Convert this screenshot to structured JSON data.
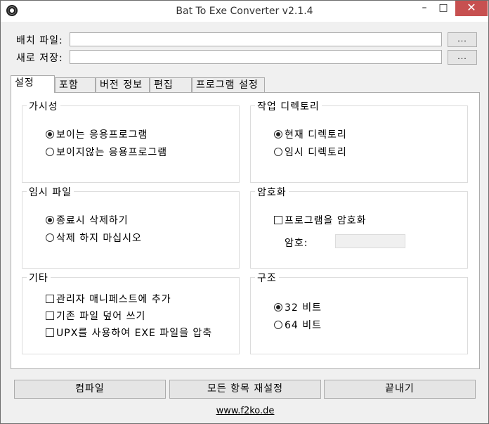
{
  "window": {
    "title": "Bat To Exe Converter v2.1.4",
    "minimize": "–",
    "maximize": "□",
    "close": "✕"
  },
  "fields": {
    "batch_file_label": "배치 파일:",
    "batch_file_value": "",
    "save_as_label": "새로 저장:",
    "save_as_value": "",
    "browse_label": "..."
  },
  "tabs": [
    {
      "label": "설정"
    },
    {
      "label": "포함"
    },
    {
      "label": "버전 정보"
    },
    {
      "label": "편집"
    },
    {
      "label": "프로그램 설정"
    }
  ],
  "settings": {
    "visibility": {
      "title": "가시성",
      "options": [
        "보이는 응용프로그램",
        "보이지않는 응용프로그램"
      ],
      "selected": 0
    },
    "working_dir": {
      "title": "작업 디렉토리",
      "options": [
        "현재 디렉토리",
        "임시 디렉토리"
      ],
      "selected": 0
    },
    "temp_file": {
      "title": "임시 파일",
      "options": [
        "종료시 삭제하기",
        "삭제 하지 마십시오"
      ],
      "selected": 0
    },
    "encryption": {
      "title": "암호화",
      "encrypt_label": "프로그램을 암호화",
      "encrypt_checked": false,
      "password_label": "암호:",
      "password_value": ""
    },
    "other": {
      "title": "기타",
      "options": [
        {
          "label": "관리자 매니페스트에 추가",
          "checked": false
        },
        {
          "label": "기존 파일 덮어 쓰기",
          "checked": false
        },
        {
          "label": "UPX를 사용하여 EXE 파일을 압축",
          "checked": false
        }
      ]
    },
    "architecture": {
      "title": "구조",
      "options": [
        "32 비트",
        "64 비트"
      ],
      "selected": 0
    }
  },
  "buttons": {
    "compile": "컴파일",
    "reset_all": "모든 항목 재설정",
    "exit": "끝내기"
  },
  "footer": {
    "link": "www.f2ko.de"
  }
}
